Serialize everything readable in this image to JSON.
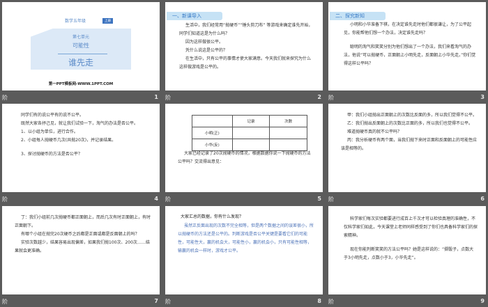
{
  "slides": [
    {
      "number": "1",
      "label": "阶",
      "grade": "数学五年级",
      "badge": "上册",
      "unit": "第七单元",
      "topic": "可能性",
      "title": "谁先走",
      "footer": "第一PPT模板网-WWW.1PPT.COM"
    },
    {
      "number": "2",
      "label": "阶",
      "header": "一、新课导入",
      "paragraphs": [
        "生活中，我们经常用“抛硬币”“锤头剪刀布” 等游戏来确定谁先开始，同学们知道这是为什么吗？",
        "因为这样做很公平。",
        "凭什么说这是公平的？",
        "在生活中，只有公平的事情才使大家满意。今天我们就来探究为什么这样做游戏是公平的。"
      ]
    },
    {
      "number": "3",
      "label": "阶",
      "header": "二、探究新知",
      "paragraphs": [
        "小明和小华准备下棋，在决定谁先走时他们都很谦让，为了公平起见，你能帮他们想一个办法，决定谁先走吗？",
        "聪明的淘气和笑笑分别为他们想出了一个办法，我们来看淘气的办法，他说“可以抛硬币，正面朝上小明先走，反面朝上小华先走。”你们觉得这样公平吗？"
      ]
    },
    {
      "number": "4",
      "label": "阶",
      "paragraphs": [
        "同学们有的说公平有的说不公平。",
        "既然大家各抒己见，就让我们试验一下，淘气的办法是否公平。",
        "1、以小组为单位，进行合作。",
        "2、小组每人抛硬币几次(共抛20次)，并记录结果。",
        "3、探讨抛硬币的方法是否公平？"
      ]
    },
    {
      "number": "5",
      "label": "阶",
      "table": {
        "headers": [
          "",
          "记录",
          "次数"
        ],
        "rows": [
          [
            "小明(正)",
            "",
            ""
          ],
          [
            "小华(反)",
            "",
            ""
          ]
        ]
      },
      "paragraphs": [
        "大家已经记录了20次抛硬币的情况，根据数据你说一下抛硬币的方法公平吗？交流得出意见："
      ]
    },
    {
      "number": "6",
      "label": "阶",
      "paragraphs": [
        "甲：我们小组抛出正面朝上的次数比反面的多，所以我们觉得不公平。",
        "乙：我们抛出反面朝上的次数比正面的多，所以我们也觉得不公平。",
        "难道抛硬币真的就不公平吗？",
        "丙：我分析硬币有两个面，当我们抛下来时正面和反面朝上的可能性应该是相等的。"
      ]
    },
    {
      "number": "7",
      "label": "阶",
      "paragraphs": [
        "丁：我们小组前几次抛硬币都正面朝上，而后几次有时正面朝上，有时正面朝下。",
        "有哪个小组在抛完20次硬币之后都是正面或都是反面朝上的吗？",
        "实验次数越少，结果容易出现偏差，如果我们抛100次、200次……结果就会更准确。"
      ]
    },
    {
      "number": "8",
      "label": "阶",
      "question": "大家汇总的数据，你有什么发现？",
      "paragraphs": [
        "虽然正反面出现的次数不完全相等，但是两个数据之间的误差很小，所以抛硬币的方法还是公平的。判断游戏是否公平关键是要看它们的可能性，可能性大，赢的机会大，可能性小，赢的机会小，只有可能性相等，输赢的机会一样时，游戏才公平。"
      ]
    },
    {
      "number": "9",
      "label": "阶",
      "paragraphs": [
        "科学家们每次实验都要进行成百上千次才可以检验真理的准确性，不仅科学家们如此，今天课堂上老师同样感受到了你们也具备科学家们的探索精神。",
        "现在你能判断笑笑的方法公平吗？她是这样说的：“掷骰子，点数大于3小明先走，点数小于3，小华先走”。"
      ]
    }
  ],
  "colors": {
    "background": "#5b5b5b",
    "accent": "#3d74c0",
    "header_bar": "#c6e2f5",
    "answer_text": "#4d73b8"
  }
}
